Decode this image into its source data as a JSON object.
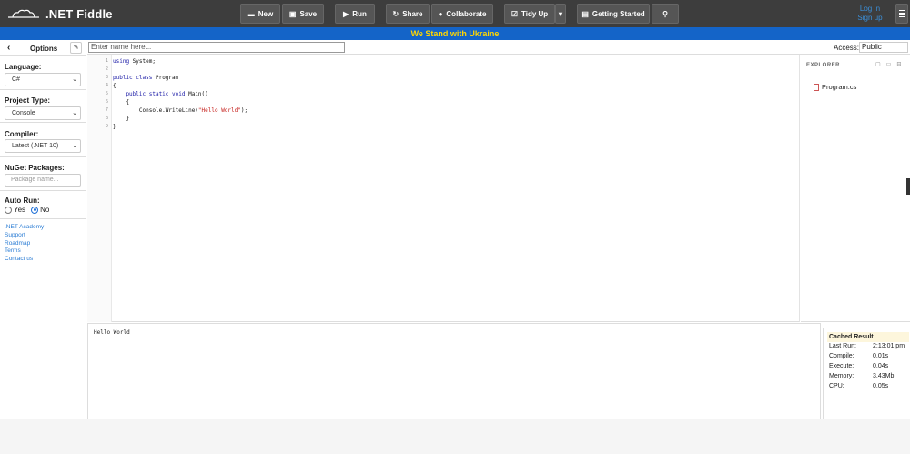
{
  "app": {
    "title": ".NET Fiddle"
  },
  "toolbar": {
    "new_label": "New",
    "save_label": "Save",
    "run_label": "Run",
    "share_label": "Share",
    "collaborate_label": "Collaborate",
    "tidy_label": "Tidy Up",
    "getting_started_label": "Getting Started"
  },
  "auth": {
    "login": "Log In",
    "signup": "Sign up"
  },
  "banner": {
    "text": "We Stand with Ukraine"
  },
  "sidebar": {
    "title": "Options",
    "language": {
      "label": "Language:",
      "value": "C#"
    },
    "project_type": {
      "label": "Project Type:",
      "value": "Console"
    },
    "compiler": {
      "label": "Compiler:",
      "value": "Latest (.NET 10)"
    },
    "nuget": {
      "label": "NuGet Packages:",
      "placeholder": "Package name..."
    },
    "auto_run": {
      "label": "Auto Run:",
      "yes": "Yes",
      "no": "No",
      "selected": "No"
    },
    "links": [
      ".NET Academy",
      "Support",
      "Roadmap",
      "Terms",
      "Contact us"
    ]
  },
  "namebar": {
    "placeholder": "Enter name here...",
    "access_label": "Access:",
    "access_value": "Public"
  },
  "editor": {
    "line_numbers": [
      "1",
      "2",
      "3",
      "4",
      "5",
      "6",
      "7",
      "8",
      "9"
    ],
    "lines": [
      {
        "a": "using",
        "b": " System;",
        "c": "",
        "d": ""
      },
      {
        "a": "",
        "b": "",
        "c": "",
        "d": ""
      },
      {
        "a": "public class",
        "b": " Program",
        "c": "",
        "d": ""
      },
      {
        "a": "",
        "b": "{",
        "c": "",
        "d": ""
      },
      {
        "a": "    public static void",
        "b": " Main()",
        "c": "",
        "d": ""
      },
      {
        "a": "",
        "b": "    {",
        "c": "",
        "d": ""
      },
      {
        "a": "",
        "b": "        Console.WriteLine(",
        "c": "\"Hello World\"",
        "d": ");"
      },
      {
        "a": "",
        "b": "    }",
        "c": "",
        "d": ""
      },
      {
        "a": "",
        "b": "}",
        "c": "",
        "d": ""
      }
    ]
  },
  "explorer": {
    "title": "EXPLORER",
    "files": [
      "Program.cs"
    ]
  },
  "output": {
    "text": "Hello World"
  },
  "stats": {
    "title": "Cached Result",
    "rows": [
      {
        "k": "Last Run:",
        "v": "2:13:01 pm"
      },
      {
        "k": "Compile:",
        "v": "0.01s"
      },
      {
        "k": "Execute:",
        "v": "0.04s"
      },
      {
        "k": "Memory:",
        "v": "3.43Mb"
      },
      {
        "k": "CPU:",
        "v": "0.05s"
      }
    ]
  },
  "colors": {
    "topbar": "#3d3d3d",
    "banner_bg": "#1464c8",
    "banner_text": "#ffd700",
    "link": "#3b8fd9"
  }
}
